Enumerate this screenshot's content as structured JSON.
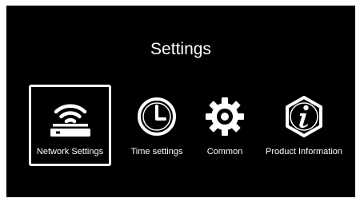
{
  "screen": {
    "title": "Settings"
  },
  "menu": {
    "selected_index": 0,
    "items": [
      {
        "label": "Network Settings",
        "icon": "wifi-router-icon",
        "selected": true
      },
      {
        "label": "Time settings",
        "icon": "clock-icon",
        "selected": false
      },
      {
        "label": "Common",
        "icon": "gear-icon",
        "selected": false
      },
      {
        "label": "Product Information",
        "icon": "info-icon",
        "selected": false
      }
    ]
  },
  "colors": {
    "background": "#000000",
    "foreground": "#ffffff",
    "frame": "#ffffff"
  }
}
